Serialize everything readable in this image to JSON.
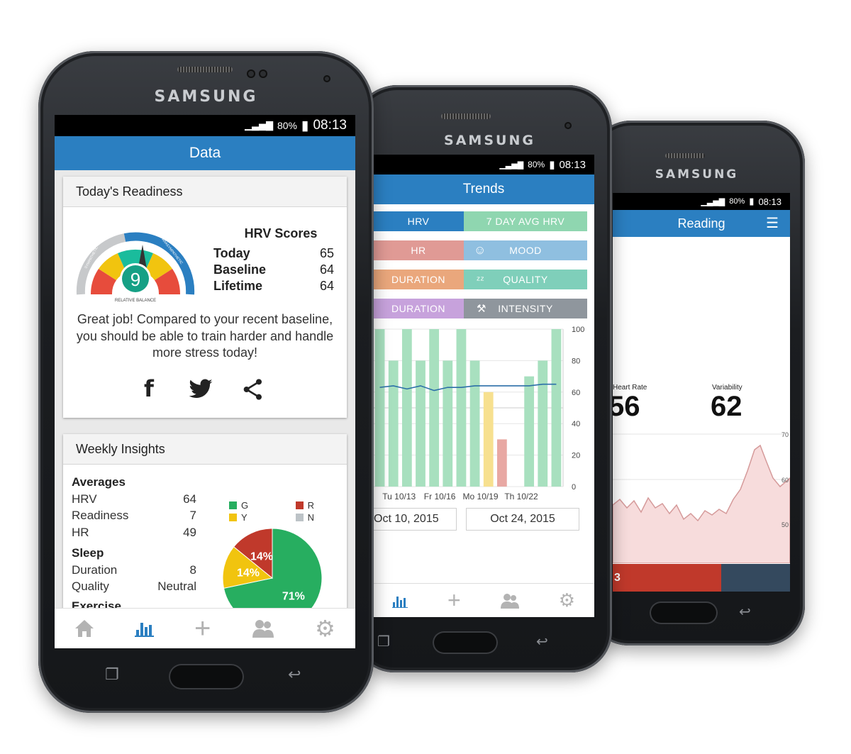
{
  "brand": "SAMSUNG",
  "status": {
    "battery": "80%",
    "time": "08:13"
  },
  "phone1": {
    "title": "Data",
    "readiness": {
      "heading": "Today's Readiness",
      "gauge_value": "9",
      "gauge_left_label": "SYMPATHETIC",
      "gauge_right_label": "PARASYMPATHETIC",
      "gauge_bottom_label": "RELATIVE BALANCE",
      "scores_title": "HRV Scores",
      "scores": [
        {
          "label": "Today",
          "value": "65"
        },
        {
          "label": "Baseline",
          "value": "64"
        },
        {
          "label": "Lifetime",
          "value": "64"
        }
      ],
      "message": "Great job! Compared to your recent baseline, you should be able to train harder and handle more stress today!",
      "share_icons": [
        "facebook-icon",
        "twitter-icon",
        "share-icon"
      ]
    },
    "weekly": {
      "heading": "Weekly Insights",
      "averages_title": "Averages",
      "averages": [
        {
          "label": "HRV",
          "value": "64"
        },
        {
          "label": "Readiness",
          "value": "7"
        },
        {
          "label": "HR",
          "value": "49"
        }
      ],
      "sleep_title": "Sleep",
      "sleep": [
        {
          "label": "Duration",
          "value": "8"
        },
        {
          "label": "Quality",
          "value": "Neutral"
        }
      ],
      "exercise_title": "Exercise",
      "legend": [
        {
          "key": "G",
          "color": "#27ae60"
        },
        {
          "key": "R",
          "color": "#c0392b"
        },
        {
          "key": "Y",
          "color": "#f1c40f"
        },
        {
          "key": "N",
          "color": "#bdc3c7"
        }
      ],
      "pie": [
        {
          "label": "71%",
          "value": 71,
          "color": "#27ae60"
        },
        {
          "label": "14%",
          "value": 14,
          "color": "#f1c40f"
        },
        {
          "label": "14%",
          "value": 14,
          "color": "#c0392b"
        }
      ]
    },
    "tabs": [
      "home-icon",
      "chart-icon",
      "add-icon",
      "people-icon",
      "settings-icon"
    ],
    "active_tab": 1
  },
  "phone2": {
    "title": "Trends",
    "pills": [
      {
        "left": "HRV",
        "left_color": "#2b7fc1",
        "right": "7 DAY AVG HRV",
        "right_color": "#8fd6b0",
        "right_icon": ""
      },
      {
        "left": "HR",
        "left_color": "#e09a95",
        "right": "MOOD",
        "right_color": "#8fbfe0",
        "right_icon": "☺"
      },
      {
        "left": "DURATION",
        "left_color": "#eaa77c",
        "right": "QUALITY",
        "right_color": "#7fcfba",
        "right_icon": "ᶻᶻ"
      },
      {
        "left": "DURATION",
        "left_color": "#c7a2dc",
        "right": "INTENSITY",
        "right_color": "#8f969d",
        "right_icon": "⚒"
      }
    ],
    "date_from": "Oct 10, 2015",
    "date_to": "Oct 24, 2015",
    "chart_data": {
      "type": "bar",
      "y_ticks": [
        "100",
        "80",
        "60",
        "40",
        "20",
        "0"
      ],
      "ylim": [
        0,
        100
      ],
      "x_labels": [
        "Tu 10/13",
        "Fr 10/16",
        "Mo 10/19",
        "Th 10/22"
      ],
      "values": [
        100,
        80,
        100,
        80,
        100,
        80,
        100,
        80,
        60,
        30,
        0,
        70,
        80,
        100
      ],
      "colors": [
        "#a8e0bf",
        "#a8e0bf",
        "#a8e0bf",
        "#a8e0bf",
        "#a8e0bf",
        "#a8e0bf",
        "#a8e0bf",
        "#a8e0bf",
        "#f7e08f",
        "#e8a8a3",
        "#a8e0bf",
        "#a8e0bf",
        "#a8e0bf",
        "#a8e0bf"
      ],
      "line": [
        63,
        64,
        62,
        64,
        61,
        63,
        63,
        64,
        64,
        64,
        64,
        64,
        65,
        65
      ]
    }
  },
  "phone3": {
    "title": "Reading",
    "hr_label": "Heart Rate",
    "hr_value": "56",
    "var_label": "Variability",
    "var_value": "62",
    "y_ticks": [
      "70",
      "60",
      "50"
    ],
    "bottom_value": "3"
  }
}
